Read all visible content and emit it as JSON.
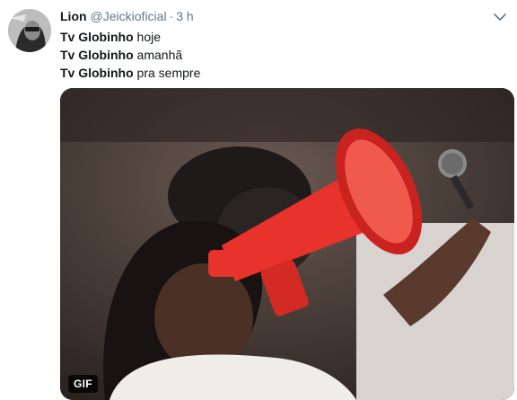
{
  "tweet": {
    "author_name": "Lion",
    "handle": "@Jeickioficial",
    "separator": "·",
    "time": "3 h",
    "lines": [
      {
        "bold": "Tv Globinho",
        "rest": " hoje"
      },
      {
        "bold": "Tv Globinho",
        "rest": " amanhã"
      },
      {
        "bold": "Tv Globinho",
        "rest": " pra sempre"
      }
    ],
    "media": {
      "badge": "GIF"
    }
  },
  "icons": {
    "menu": "chevron-down-icon",
    "avatar": "avatar"
  },
  "colors": {
    "megaphone": "#e8322c",
    "secondary_text": "#657786"
  }
}
